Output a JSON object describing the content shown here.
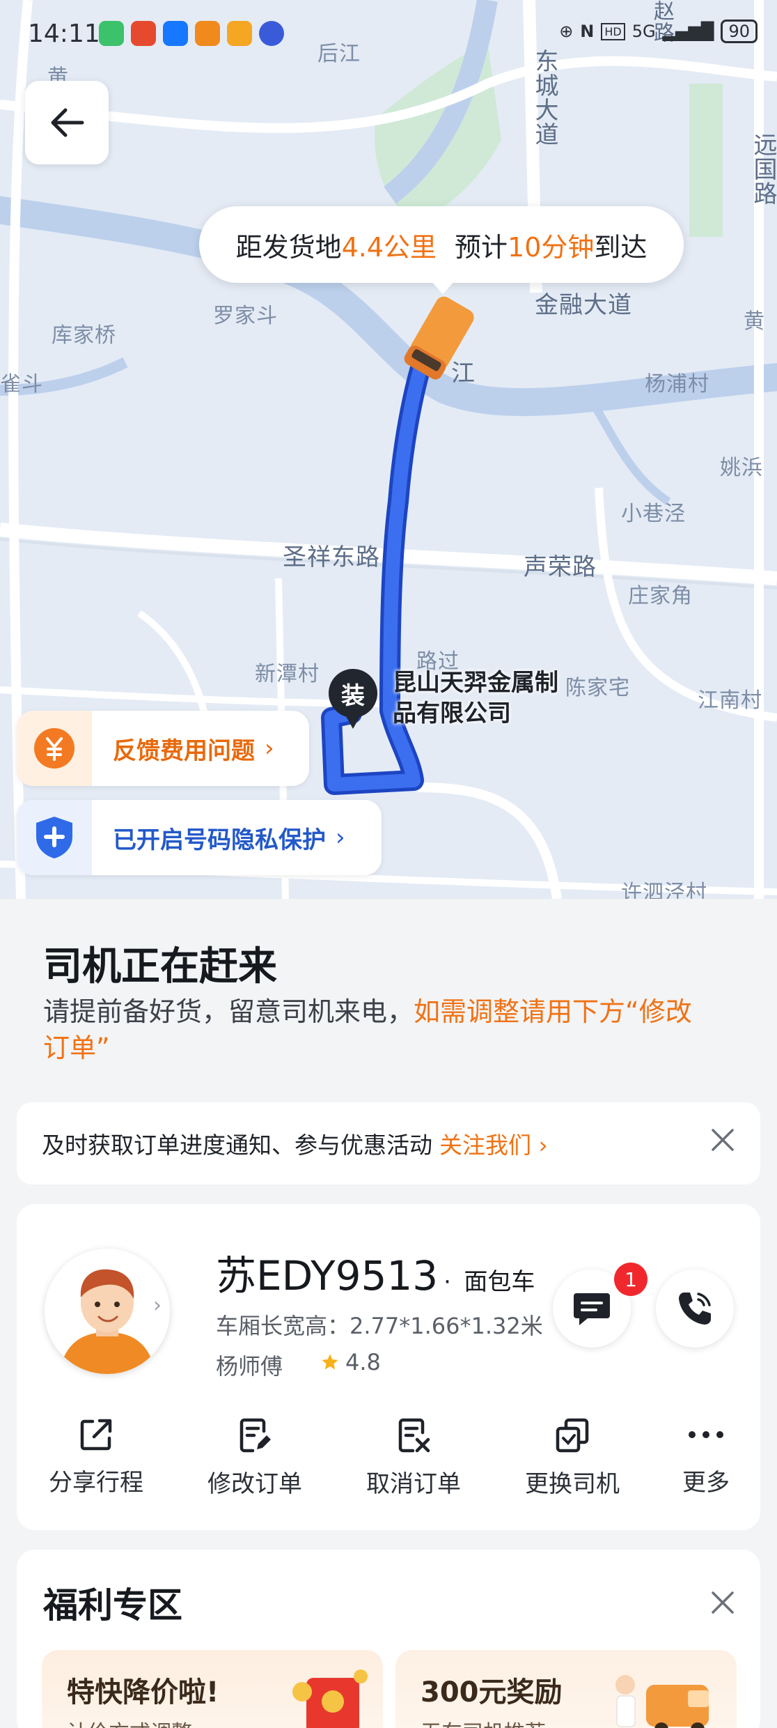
{
  "status_bar": {
    "time": "14:11",
    "network": "5G",
    "battery": "90"
  },
  "map": {
    "labels": {
      "houjiang": "后江",
      "dongcheng": "东城大道",
      "yuanguo": "远国路",
      "jinrong": "金融大道",
      "huang": "黄",
      "huang2": "黄",
      "luojiadou": "罗家斗",
      "kujiaqiao": "库家桥",
      "quedou": "雀斗",
      "yangpu": "杨浦村",
      "yaobang": "姚浜",
      "xiaoxiangjing": "小巷泾",
      "shengxiang": "圣祥东路",
      "shengrong": "声荣路",
      "zhuangjiajiao": "庄家角",
      "xintan": "新潭村",
      "luguo": "路过",
      "chenjiazhai": "陈家宅",
      "jiangnan": "江南村",
      "xusijing": "许泗泾村",
      "jiang": "江",
      "zhaolu": "赵路"
    },
    "eta": {
      "prefix": "距发货地",
      "distance": "4.4公里",
      "mid": "预计",
      "time": "10分钟",
      "suffix": "到达"
    },
    "load_pin": "装",
    "load_name_line1": "昆山天羿金属制",
    "load_name_line2": "品有限公司",
    "fee_chip": {
      "label": "反馈费用问题",
      "arrow": "›"
    },
    "privacy_chip": {
      "label": "已开启号码隐私保护",
      "arrow": "›"
    }
  },
  "order_status": {
    "title": "司机正在赶来",
    "subtitle": "请提前备好货，留意司机来电，",
    "subtitle_highlight": "如需调整请用下方“修改订单”"
  },
  "notify": {
    "text": "及时获取订单进度通知、参与优惠活动",
    "action": "关注我们 ›"
  },
  "driver": {
    "plate": "苏EDY9513",
    "dot": "·",
    "vehicle_type": "面包车",
    "cabin": "车厢长宽高：2.77*1.66*1.32米",
    "name": "杨师傅",
    "rating": "4.8",
    "unread": "1"
  },
  "actions": [
    {
      "label": "分享行程",
      "icon": "share-icon"
    },
    {
      "label": "修改订单",
      "icon": "edit-order-icon"
    },
    {
      "label": "取消订单",
      "icon": "cancel-order-icon"
    },
    {
      "label": "更换司机",
      "icon": "swap-driver-icon"
    },
    {
      "label": "更多",
      "icon": "more-icon"
    }
  ],
  "welfare": {
    "title": "福利专区",
    "promos": [
      {
        "title": "特快降价啦!",
        "sub": "计价方式调整"
      },
      {
        "title": "300元奖励",
        "sub": "无车司机推荐"
      }
    ]
  },
  "colors": {
    "accent": "#f07214",
    "route": "#2f62e0",
    "privacy": "#2359c9"
  }
}
